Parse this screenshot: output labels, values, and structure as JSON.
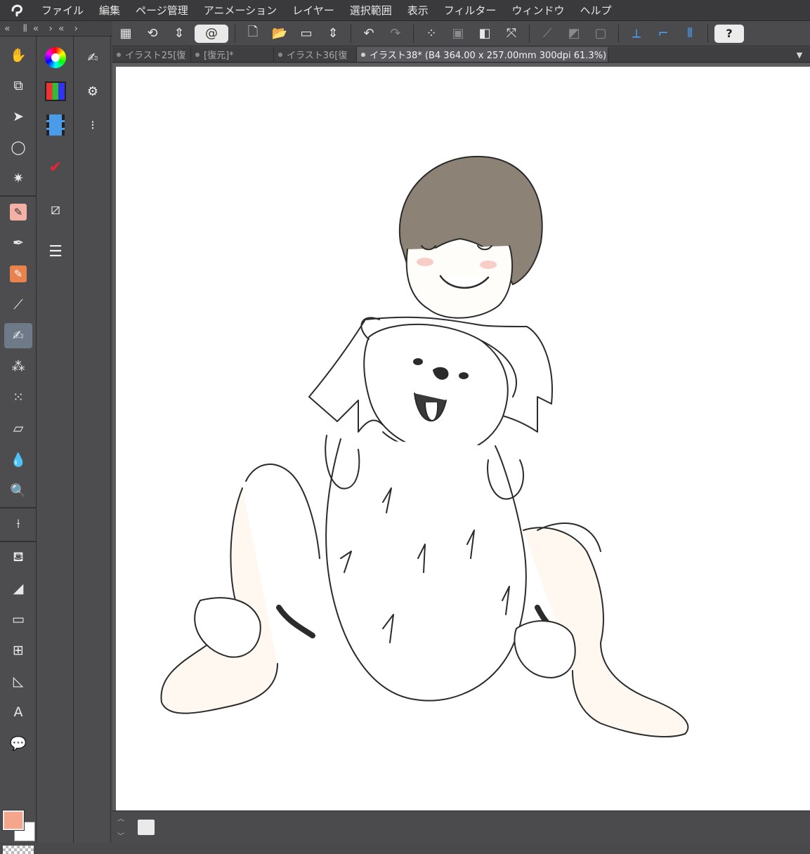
{
  "menubar": {
    "items": [
      "ファイル",
      "編集",
      "ページ管理",
      "アニメーション",
      "レイヤー",
      "選択範囲",
      "表示",
      "フィルター",
      "ウィンドウ",
      "ヘルプ"
    ]
  },
  "tabs": [
    {
      "label": "イラスト25[復",
      "active": false
    },
    {
      "label": "[復元]*",
      "active": false
    },
    {
      "label": "イラスト36[復",
      "active": false
    },
    {
      "label": "イラスト38* (B4 364.00 x 257.00mm 300dpi 61.3%)",
      "active": true
    }
  ],
  "colors": {
    "main_color": "#f4a58c",
    "sub_color": "#ffffff",
    "ui_bg": "#4d4d50",
    "canvas_bg": "#ffffff",
    "accent_blue": "#4aa3ff"
  },
  "tools": [
    "hand-icon",
    "zoom-rotate-icon",
    "move-icon",
    "lasso-select-icon",
    "magic-wand-icon",
    "eyedropper-icon",
    "pen-icon",
    "pencil-icon",
    "brush-icon",
    "ink-pen-icon",
    "watercolor-brush-icon",
    "airbrush-icon",
    "decoration-icon",
    "eraser-icon",
    "blend-icon",
    "fill-icon",
    "line-tool-icon",
    "gradient-icon",
    "curve-icon",
    "rectangle-icon",
    "frame-icon",
    "ruler-icon",
    "text-icon",
    "balloon-icon"
  ],
  "palettes": [
    "color-wheel-icon",
    "color-set-icon",
    "animation-icon",
    "history-icon",
    "material-icon",
    "layer-icon"
  ],
  "subtools": [
    "subtool-brush-icon",
    "subtool-settings-icon",
    "subtool-options-icon"
  ],
  "toolbar": {
    "buttons": [
      "layout-icon",
      "transform-icon",
      "updown-icon",
      "clip-icon",
      "new-icon",
      "open-icon",
      "save-icon",
      "updown-icon",
      "undo-icon",
      "redo-icon",
      "dots-icon",
      "crop-icon",
      "fill-icon",
      "select-transform-icon",
      "snap-ruler-icon",
      "snap-grid-icon",
      "snap-special-icon",
      "ruler-snap-icon",
      "perspective-icon",
      "symmetry-icon",
      "help-icon"
    ]
  }
}
